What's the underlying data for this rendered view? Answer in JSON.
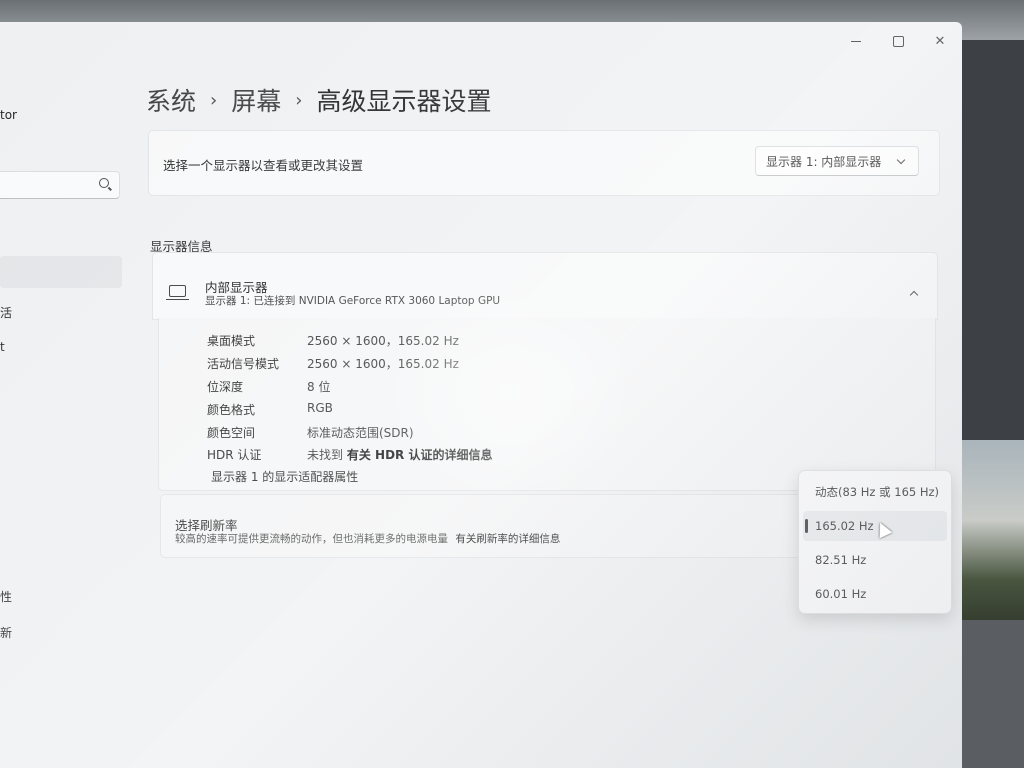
{
  "window": {
    "caption_minimize": "",
    "caption_maximize": "",
    "caption_close": "✕"
  },
  "sidebar": {
    "title_fragment": "tor",
    "item_fragment_1": "活",
    "item_fragment_2": "t",
    "item_fragment_3": "性",
    "item_fragment_4": "新"
  },
  "breadcrumb": {
    "items": [
      "系统",
      "屏幕",
      "高级显示器设置"
    ],
    "separator": "›"
  },
  "display_selector": {
    "label": "选择一个显示器以查看或更改其设置",
    "selected": "显示器 1: 内部显示器"
  },
  "display_info": {
    "section_title": "显示器信息",
    "name": "内部显示器",
    "subtitle": "显示器 1: 已连接到 NVIDIA GeForce RTX 3060 Laptop GPU",
    "rows": [
      {
        "key": "桌面模式",
        "value": "2560 × 1600，165.02 Hz"
      },
      {
        "key": "活动信号模式",
        "value": "2560 × 1600，165.02 Hz"
      },
      {
        "key": "位深度",
        "value": "8 位"
      },
      {
        "key": "颜色格式",
        "value": "RGB"
      },
      {
        "key": "颜色空间",
        "value": "标准动态范围(SDR)"
      },
      {
        "key": "HDR 认证",
        "value_prefix": "未找到",
        "value_link": "有关 HDR 认证的详细信息"
      }
    ],
    "adapter_link": "显示器 1 的显示适配器属性"
  },
  "refresh_rate": {
    "title": "选择刷新率",
    "description": "较高的速率可提供更流畅的动作，但也消耗更多的电源电量",
    "link": "有关刷新率的详细信息",
    "options": [
      "动态(83 Hz 或 165 Hz)",
      "165.02 Hz",
      "82.51 Hz",
      "60.01 Hz"
    ],
    "selected": "165.02 Hz"
  }
}
